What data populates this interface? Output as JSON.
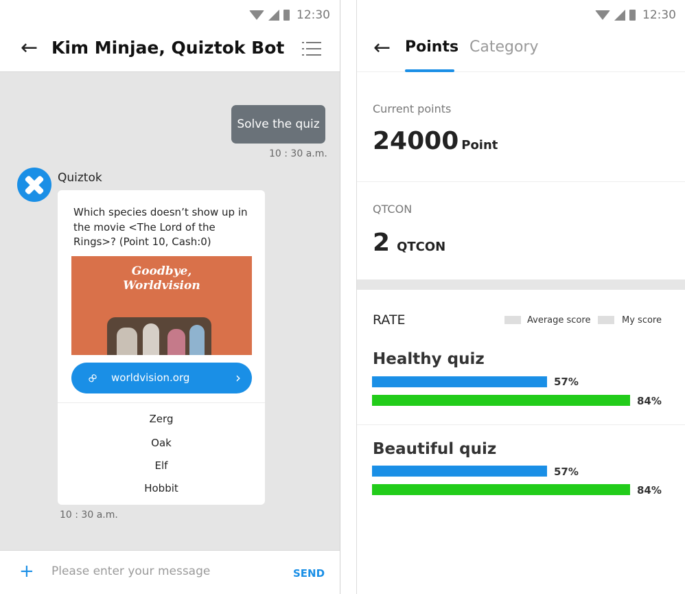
{
  "status": {
    "time": "12:30"
  },
  "chat": {
    "title": "Kim Minjae, Quiztok Bot",
    "outgoing": {
      "text": "Solve the quiz",
      "time": "10 : 30 a.m."
    },
    "bot": {
      "name": "Quiztok",
      "question": "Which species doesn’t show up in the movie <The Lord of the Rings>? (Point 10, Cash:0)",
      "image_caption_line1": "Goodbye,",
      "image_caption_line2": "Worldvision",
      "link_label": "worldvision.org",
      "options": [
        "Zerg",
        "Oak",
        "Elf",
        "Hobbit"
      ],
      "time": "10 : 30 a.m."
    },
    "composer": {
      "placeholder": "Please enter your message",
      "send_label": "SEND"
    },
    "colors": {
      "accent": "#1a8fe6",
      "outgoing_bubble": "#6a7279",
      "background": "#e5e5e5"
    }
  },
  "points_screen": {
    "tabs": [
      {
        "label": "Points",
        "active": true
      },
      {
        "label": "Category",
        "active": false
      }
    ],
    "current_points": {
      "label": "Current points",
      "value": "24000",
      "unit": "Point"
    },
    "qtcon": {
      "label": "QTCON",
      "value": "2",
      "unit": "QTCON"
    },
    "rate": {
      "label": "RATE",
      "legend": [
        "Average score",
        "My score"
      ],
      "quizzes": [
        {
          "name": "Healthy quiz",
          "average_pct": 57,
          "average_label": "57%",
          "my_pct": 84,
          "my_label": "84%"
        },
        {
          "name": "Beautiful quiz",
          "average_pct": 57,
          "average_label": "57%",
          "my_pct": 84,
          "my_label": "84%"
        }
      ]
    },
    "colors": {
      "average_bar": "#1a8fe6",
      "my_bar": "#22cc1a"
    }
  }
}
